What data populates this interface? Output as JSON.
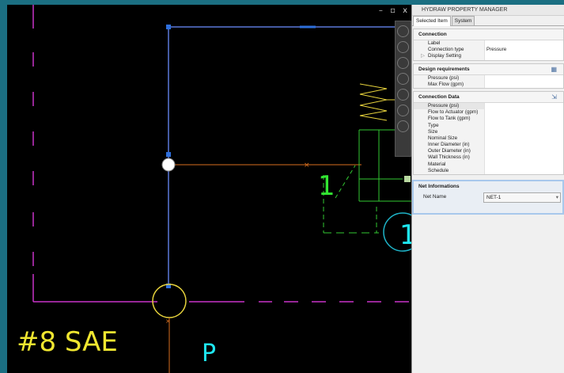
{
  "window_controls": {
    "minimize": "–",
    "restore": "▫",
    "close": "x"
  },
  "canvas": {
    "label_sae": "#8 SAE",
    "label_port": "P",
    "label_valve": "1",
    "label_circle": "1",
    "colors": {
      "blue": "#3a5fcd",
      "magenta": "#c832c8",
      "yellow": "#e6d23c",
      "green": "#32c832",
      "cyan": "#1ee6f0",
      "orange": "#d76e1e"
    }
  },
  "panel": {
    "title": "HYDRAW PROPERTY MANAGER",
    "tabs": [
      {
        "label": "Selected Item"
      },
      {
        "label": "System"
      }
    ],
    "connection": {
      "header": "Connection",
      "rows": [
        {
          "key": "Label",
          "value": ""
        },
        {
          "key": "Connection type",
          "value": "Pressure"
        },
        {
          "key": "Display Setting",
          "value": ""
        }
      ]
    },
    "design": {
      "header": "Design requirements",
      "rows": [
        {
          "key": "Pressure (psi)",
          "value": ""
        },
        {
          "key": "Max Flow (gpm)",
          "value": ""
        }
      ]
    },
    "connection_data": {
      "header": "Connection Data",
      "rows": [
        {
          "key": "Pressure (psi)",
          "value": ""
        },
        {
          "key": "Flow to Actuator (gpm)",
          "value": ""
        },
        {
          "key": "Flow to Tank (gpm)",
          "value": ""
        },
        {
          "key": "Type",
          "value": ""
        },
        {
          "key": "Size",
          "value": ""
        },
        {
          "key": "Nominal Size",
          "value": ""
        },
        {
          "key": "Inner Diameter (in)",
          "value": ""
        },
        {
          "key": "Outer Diameter (in)",
          "value": ""
        },
        {
          "key": "Wall Thickness (in)",
          "value": ""
        },
        {
          "key": "Material",
          "value": ""
        },
        {
          "key": "Schedule",
          "value": ""
        }
      ]
    },
    "net": {
      "header": "Net Informations",
      "key": "Net Name",
      "value": "NET-1"
    }
  }
}
